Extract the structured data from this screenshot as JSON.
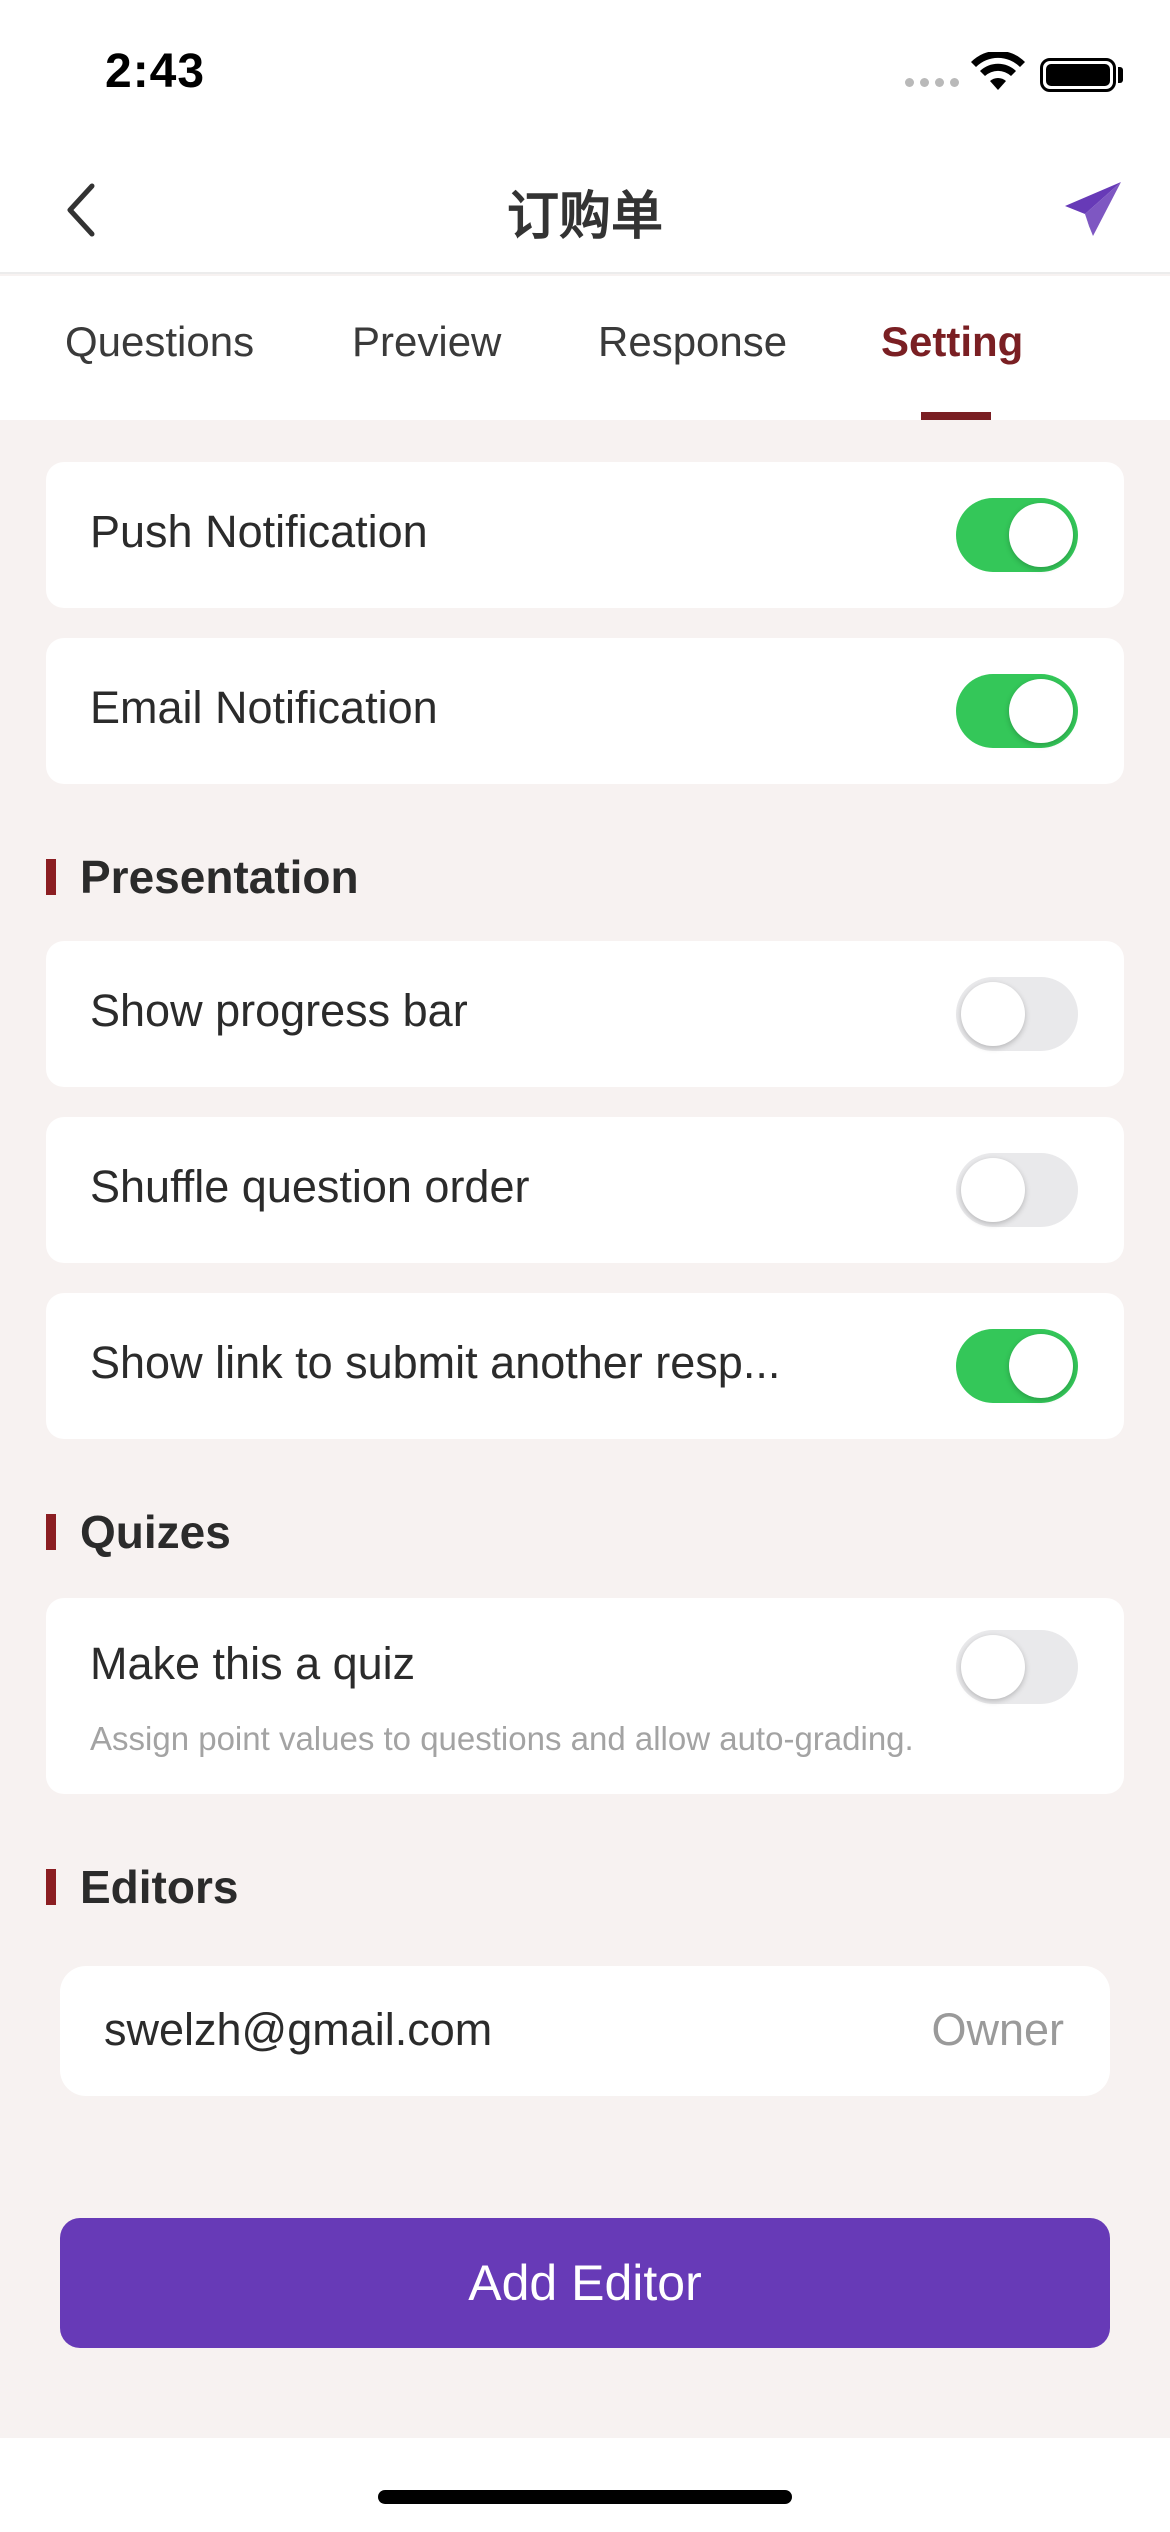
{
  "status_bar": {
    "time": "2:43"
  },
  "nav": {
    "title": "订购单",
    "back_icon": "chevron-left-icon",
    "send_icon": "paper-plane-icon",
    "accent_color": "#673ab7"
  },
  "tabs": [
    {
      "label": "Questions",
      "active": false
    },
    {
      "label": "Preview",
      "active": false
    },
    {
      "label": "Response",
      "active": false
    },
    {
      "label": "Setting",
      "active": true
    }
  ],
  "notifications": [
    {
      "label": "Push Notification",
      "enabled": true
    },
    {
      "label": "Email Notification",
      "enabled": true
    }
  ],
  "presentation": {
    "title": "Presentation",
    "items": [
      {
        "label": "Show progress bar",
        "enabled": false
      },
      {
        "label": "Shuffle question order",
        "enabled": false
      },
      {
        "label": "Show link to submit another resp...",
        "enabled": true
      }
    ]
  },
  "quizes": {
    "title": "Quizes",
    "item": {
      "label": "Make this a quiz",
      "description": "Assign point values to questions and allow auto-grading.",
      "enabled": false
    }
  },
  "editors": {
    "title": "Editors",
    "list": [
      {
        "email": "swelzh@gmail.com",
        "role": "Owner"
      }
    ],
    "add_label": "Add Editor"
  },
  "colors": {
    "toggle_on": "#34c759",
    "toggle_off": "#e9e9eb",
    "tab_active": "#7a1f23",
    "section_bar": "#8b1e22",
    "button": "#673ab7"
  }
}
